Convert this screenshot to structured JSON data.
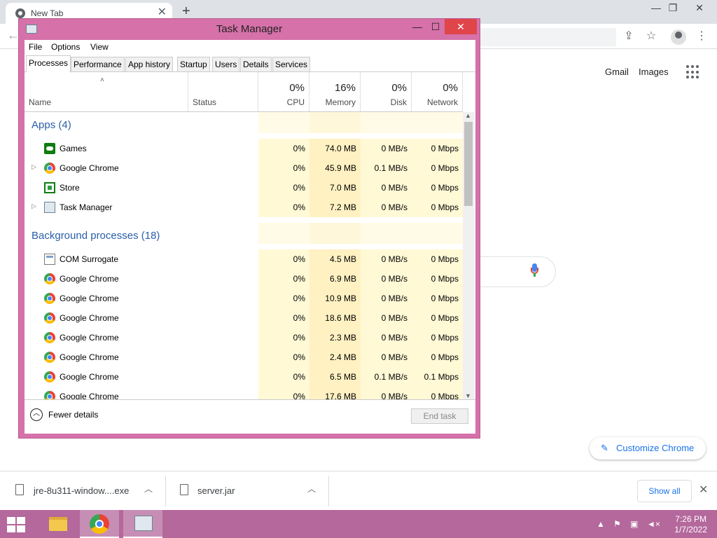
{
  "browser": {
    "tab_title": "New Tab",
    "tab_close": "✕",
    "new_tab": "+",
    "win_minimize": "—",
    "win_restore": "❐",
    "win_close": "✕",
    "gmail": "Gmail",
    "images": "Images",
    "customize": "Customize Chrome"
  },
  "downloads": {
    "items": [
      {
        "name": "jre-8u311-window....exe"
      },
      {
        "name": "server.jar"
      }
    ],
    "show_all": "Show all",
    "close": "✕"
  },
  "taskbar": {
    "time": "7:26 PM",
    "date": "1/7/2022"
  },
  "task_manager": {
    "title": "Task Manager",
    "menu": [
      "File",
      "Options",
      "View"
    ],
    "tabs": [
      "Processes",
      "Performance",
      "App history",
      "Startup",
      "Users",
      "Details",
      "Services"
    ],
    "active_tab": "Processes",
    "columns": {
      "name": "Name",
      "status": "Status",
      "cpu": {
        "pct": "0%",
        "label": "CPU"
      },
      "memory": {
        "pct": "16%",
        "label": "Memory"
      },
      "disk": {
        "pct": "0%",
        "label": "Disk"
      },
      "network": {
        "pct": "0%",
        "label": "Network"
      }
    },
    "groups": [
      {
        "header": "Apps (4)",
        "rows": [
          {
            "name": "Games",
            "icon": "games-icon",
            "expandable": false,
            "cpu": "0%",
            "memory": "74.0 MB",
            "disk": "0 MB/s",
            "network": "0 Mbps"
          },
          {
            "name": "Google Chrome",
            "icon": "chrome-icon",
            "expandable": true,
            "cpu": "0%",
            "memory": "45.9 MB",
            "disk": "0.1 MB/s",
            "network": "0 Mbps"
          },
          {
            "name": "Store",
            "icon": "store-icon",
            "expandable": false,
            "cpu": "0%",
            "memory": "7.0 MB",
            "disk": "0 MB/s",
            "network": "0 Mbps"
          },
          {
            "name": "Task Manager",
            "icon": "task-manager-icon",
            "expandable": true,
            "cpu": "0%",
            "memory": "7.2 MB",
            "disk": "0 MB/s",
            "network": "0 Mbps"
          }
        ]
      },
      {
        "header": "Background processes (18)",
        "rows": [
          {
            "name": "COM Surrogate",
            "icon": "com-surrogate-icon",
            "expandable": false,
            "cpu": "0%",
            "memory": "4.5 MB",
            "disk": "0 MB/s",
            "network": "0 Mbps"
          },
          {
            "name": "Google Chrome",
            "icon": "chrome-icon",
            "expandable": false,
            "cpu": "0%",
            "memory": "6.9 MB",
            "disk": "0 MB/s",
            "network": "0 Mbps"
          },
          {
            "name": "Google Chrome",
            "icon": "chrome-icon",
            "expandable": false,
            "cpu": "0%",
            "memory": "10.9 MB",
            "disk": "0 MB/s",
            "network": "0 Mbps"
          },
          {
            "name": "Google Chrome",
            "icon": "chrome-icon",
            "expandable": false,
            "cpu": "0%",
            "memory": "18.6 MB",
            "disk": "0 MB/s",
            "network": "0 Mbps"
          },
          {
            "name": "Google Chrome",
            "icon": "chrome-icon",
            "expandable": false,
            "cpu": "0%",
            "memory": "2.3 MB",
            "disk": "0 MB/s",
            "network": "0 Mbps"
          },
          {
            "name": "Google Chrome",
            "icon": "chrome-icon",
            "expandable": false,
            "cpu": "0%",
            "memory": "2.4 MB",
            "disk": "0 MB/s",
            "network": "0 Mbps"
          },
          {
            "name": "Google Chrome",
            "icon": "chrome-icon",
            "expandable": false,
            "cpu": "0%",
            "memory": "6.5 MB",
            "disk": "0.1 MB/s",
            "network": "0.1 Mbps"
          },
          {
            "name": "Google Chrome",
            "icon": "chrome-icon",
            "expandable": false,
            "cpu": "0%",
            "memory": "17.6 MB",
            "disk": "0 MB/s",
            "network": "0 Mbps"
          }
        ]
      }
    ],
    "fewer_details": "Fewer details",
    "end_task": "End task"
  },
  "colors": {
    "taskbar": "#b4689c",
    "tm_frame": "#d671a9",
    "link_blue": "#1a73e8",
    "group_blue": "#2a5ea8",
    "cell_tint": "#fff9d6",
    "memory_tint": "#fff1c2"
  }
}
